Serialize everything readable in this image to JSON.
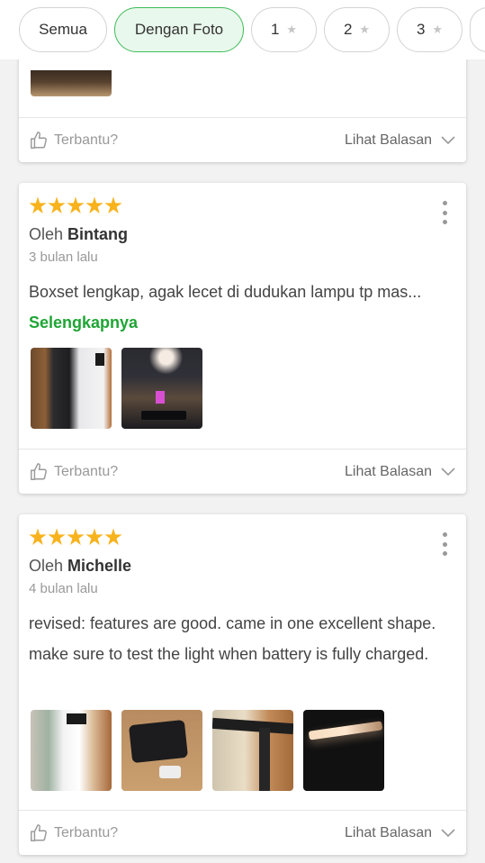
{
  "filters": [
    {
      "label": "Semua",
      "active": false,
      "kind": "all"
    },
    {
      "label": "Dengan Foto",
      "active": true,
      "kind": "photo"
    },
    {
      "label": "1",
      "active": false,
      "kind": "num"
    },
    {
      "label": "2",
      "active": false,
      "kind": "num"
    },
    {
      "label": "3",
      "active": false,
      "kind": "num"
    }
  ],
  "star_glyph": "★",
  "accent": "#1ea534",
  "star_color": "#f8b21c",
  "reviews": [
    {
      "rating": 5,
      "by_prefix": "Oleh",
      "author": "Bintang",
      "date": "3 bulan lalu",
      "text": "Boxset lengkap, agak lecet di dudukan lampu tp mas...",
      "more_label": "Selengkapnya",
      "photo_count": 2
    },
    {
      "rating": 5,
      "by_prefix": "Oleh",
      "author": "Michelle",
      "date": "4 bulan lalu",
      "text": "revised: features are good. came in one excellent shape. make sure to test the light when battery is fully charged.",
      "photo_count": 4
    }
  ],
  "footer": {
    "helpful_label": "Terbantu?",
    "replies_label": "Lihat Balasan"
  }
}
